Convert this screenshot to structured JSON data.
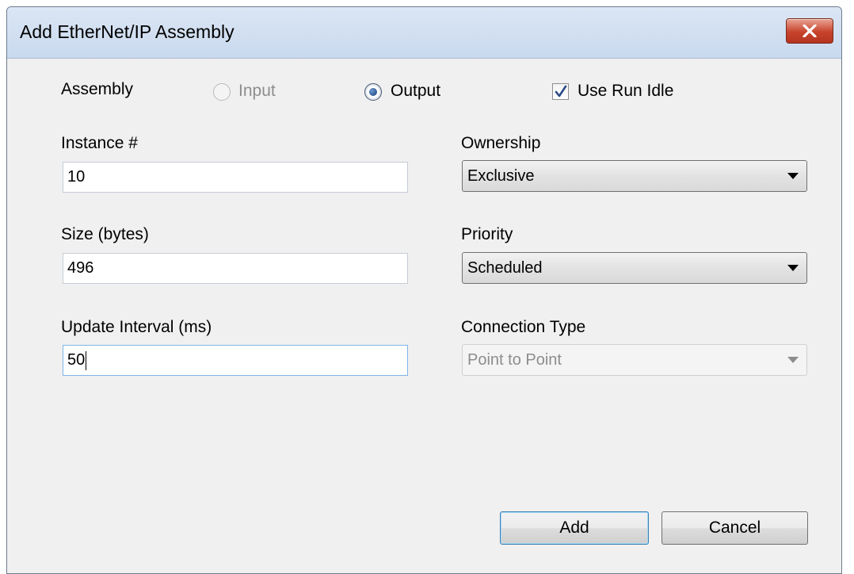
{
  "window": {
    "title": "Add EtherNet/IP Assembly",
    "close_icon": "close-x-icon"
  },
  "assembly": {
    "label": "Assembly",
    "input_label": "Input",
    "input_state": "disabled",
    "output_label": "Output",
    "output_state": "selected",
    "use_run_idle_label": "Use Run Idle",
    "use_run_idle_checked": true
  },
  "fields": {
    "instance_label": "Instance #",
    "instance_value": "10",
    "size_label": "Size (bytes)",
    "size_value": "496",
    "update_interval_label": "Update Interval (ms)",
    "update_interval_value": "50"
  },
  "dropdowns": {
    "ownership_label": "Ownership",
    "ownership_value": "Exclusive",
    "priority_label": "Priority",
    "priority_value": "Scheduled",
    "connection_type_label": "Connection Type",
    "connection_type_value": "Point to Point",
    "connection_type_state": "disabled"
  },
  "buttons": {
    "add_label": "Add",
    "cancel_label": "Cancel"
  },
  "colors": {
    "titlebar": "#d3e0f1",
    "close_button": "#c7422b",
    "dialog_background": "#f0f0f0",
    "focus_border": "#7eb4ea"
  }
}
